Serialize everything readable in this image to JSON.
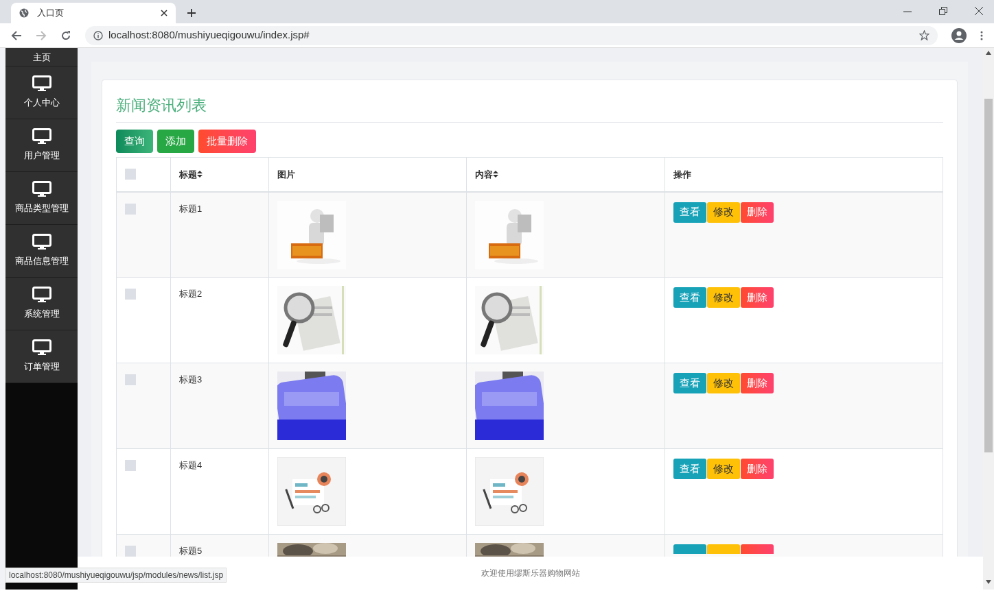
{
  "browser": {
    "tab_title": "入口页",
    "url": "localhost:8080/mushiyueqigouwu/index.jsp#",
    "status_link": "localhost:8080/mushiyueqigouwu/jsp/modules/news/list.jsp"
  },
  "sidebar": {
    "items": [
      {
        "label": "主页",
        "kind": "partial"
      },
      {
        "label": "个人中心",
        "kind": "monitor"
      },
      {
        "label": "用户管理",
        "kind": "monitor"
      },
      {
        "label": "商品类型管理",
        "kind": "monitor"
      },
      {
        "label": "商品信息管理",
        "kind": "monitor"
      },
      {
        "label": "系统管理",
        "kind": "monitor"
      },
      {
        "label": "订单管理",
        "kind": "monitor"
      }
    ]
  },
  "page": {
    "title": "新闻资讯列表",
    "toolbar": [
      {
        "label": "查询",
        "kind": "search"
      },
      {
        "label": "添加",
        "kind": "add"
      },
      {
        "label": "批量删除",
        "kind": "delete"
      }
    ]
  },
  "table": {
    "select_all_checked": false,
    "columns": [
      {
        "label": "标题",
        "sortable": true
      },
      {
        "label": "图片",
        "sortable": false
      },
      {
        "label": "内容",
        "sortable": true
      },
      {
        "label": "操作",
        "sortable": false
      }
    ],
    "rows": [
      {
        "title": "标题1",
        "checked": false,
        "kind": "full",
        "actions": [
          {
            "label": "查看",
            "kind": "view"
          },
          {
            "label": "修改",
            "kind": "edit"
          },
          {
            "label": "删除",
            "kind": "delete"
          }
        ]
      },
      {
        "title": "标题2",
        "checked": false,
        "kind": "full",
        "actions": [
          {
            "label": "查看",
            "kind": "view"
          },
          {
            "label": "修改",
            "kind": "edit"
          },
          {
            "label": "删除",
            "kind": "delete"
          }
        ]
      },
      {
        "title": "标题3",
        "checked": false,
        "kind": "full",
        "actions": [
          {
            "label": "查看",
            "kind": "view"
          },
          {
            "label": "修改",
            "kind": "edit"
          },
          {
            "label": "删除",
            "kind": "delete"
          }
        ]
      },
      {
        "title": "标题4",
        "checked": false,
        "kind": "full",
        "actions": [
          {
            "label": "查看",
            "kind": "view"
          },
          {
            "label": "修改",
            "kind": "edit"
          },
          {
            "label": "删除",
            "kind": "delete"
          }
        ]
      },
      {
        "title": "标题5",
        "checked": false,
        "kind": "partial",
        "actions": [
          {
            "kind": "view"
          },
          {
            "kind": "edit"
          },
          {
            "kind": "delete"
          }
        ]
      }
    ]
  },
  "footer": {
    "text": "欢迎使用缪斯乐器购物网站"
  }
}
